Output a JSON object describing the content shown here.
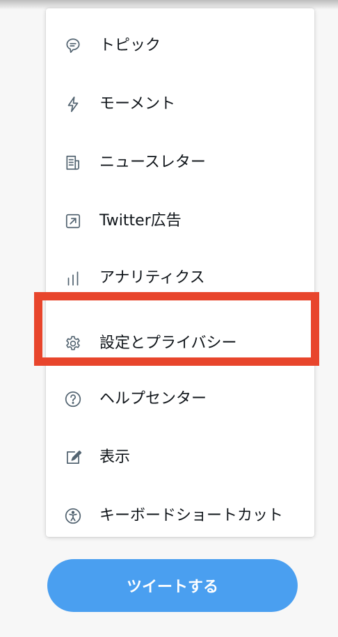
{
  "menu": {
    "items": [
      {
        "label": "トピック",
        "icon": "topics-icon"
      },
      {
        "label": "モーメント",
        "icon": "moments-icon"
      },
      {
        "label": "ニュースレター",
        "icon": "newsletter-icon"
      },
      {
        "label": "Twitter広告",
        "icon": "ads-icon"
      },
      {
        "label": "アナリティクス",
        "icon": "analytics-icon"
      },
      {
        "label": "設定とプライバシー",
        "icon": "gear-icon"
      },
      {
        "label": "ヘルプセンター",
        "icon": "help-icon"
      },
      {
        "label": "表示",
        "icon": "display-icon"
      },
      {
        "label": "キーボードショートカット",
        "icon": "accessibility-icon"
      }
    ]
  },
  "highlight": {
    "target": "設定とプライバシー",
    "color": "#e8452c"
  },
  "tweet_button": {
    "label": "ツイートする",
    "color": "#4a9ff0"
  },
  "icon_color": "#536471",
  "text_color": "#0f1419"
}
